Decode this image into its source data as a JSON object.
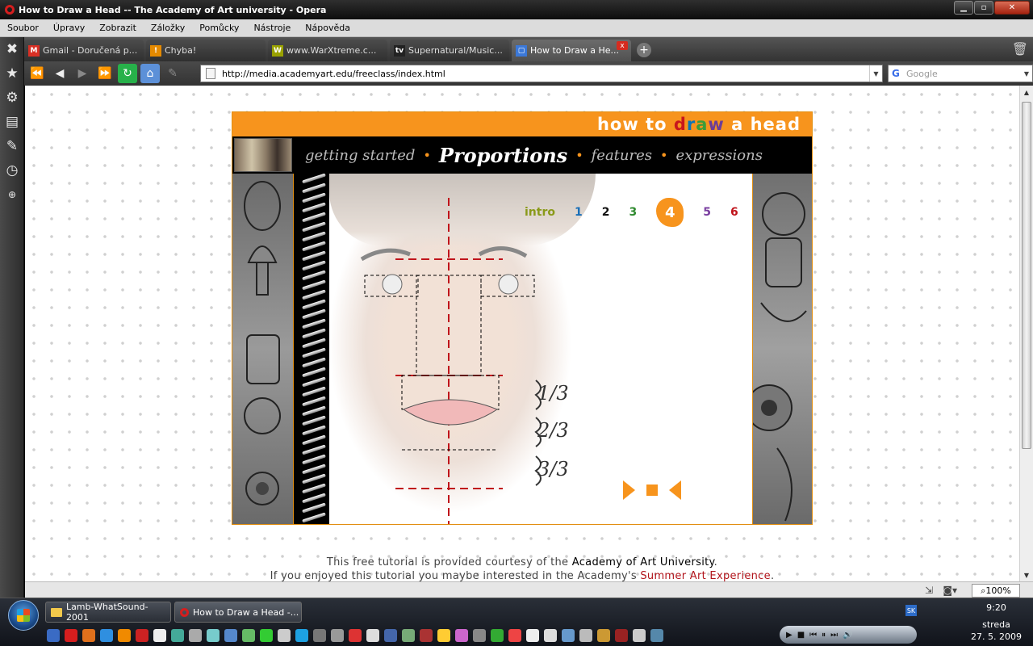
{
  "window": {
    "title": "How to Draw a Head -- The Academy of Art university - Opera",
    "minimize": "▁",
    "maximize": "▫",
    "close": "✕"
  },
  "menu": [
    "Soubor",
    "Úpravy",
    "Zobrazit",
    "Záložky",
    "Pomůcky",
    "Nástroje",
    "Nápověda"
  ],
  "tabs": [
    {
      "label": "Gmail - Doručená p...",
      "favicon": "M",
      "color": "#d93025"
    },
    {
      "label": "Chyba!",
      "favicon": "!",
      "color": "#e58a00"
    },
    {
      "label": "www.WarXtreme.c...",
      "favicon": "W",
      "color": "#9aa200"
    },
    {
      "label": "Supernatural/Music...",
      "favicon": "tv",
      "color": "#222222"
    },
    {
      "label": "How to Draw a He...",
      "favicon": "▢",
      "color": "#3b78d8",
      "active": true
    }
  ],
  "address": {
    "url": "http://media.academyart.edu/freeclass/index.html",
    "search_placeholder": "Google"
  },
  "panel_icons": [
    "bookmarks-icon",
    "settings-icon",
    "chat-icon",
    "feeds-icon",
    "history-icon",
    "add-panel-icon"
  ],
  "flash": {
    "title_start": "how to ",
    "title_d": "d",
    "title_r": "r",
    "title_a": "a",
    "title_w": "w",
    "title_end": " a head",
    "nav": {
      "getting_started": "getting started",
      "proportions": "Proportions",
      "features": "features",
      "expressions": "expressions",
      "sep": "•"
    },
    "steps": [
      {
        "label": "intro",
        "color": "#8a9a1a"
      },
      {
        "label": "1",
        "color": "#1a6fb8"
      },
      {
        "label": "2",
        "color": "#111111"
      },
      {
        "label": "3",
        "color": "#2f8a2f"
      },
      {
        "label": "4",
        "color": "#ffffff",
        "current": true
      },
      {
        "label": "5",
        "color": "#7a3fa0"
      },
      {
        "label": "6",
        "color": "#c0141b"
      }
    ],
    "fractions": [
      "1/3",
      "2/3",
      "3/3"
    ]
  },
  "credits": {
    "line1_pre": "This free tutorial is provided courtesy of the ",
    "line1_link": "Academy of Art University",
    "line1_post": ".",
    "line2_pre": "If you enjoyed this tutorial you maybe interested in the Academy's ",
    "line2_link": "Summer Art Experience",
    "line2_post": "."
  },
  "status": {
    "zoom": "100%"
  },
  "taskbar": {
    "buttons": [
      {
        "label": "Lamb-WhatSound-2001"
      },
      {
        "label": "How to Draw a Head -..."
      }
    ],
    "time": "9:20",
    "day": "streda",
    "date": "27. 5. 2009",
    "lang": "SK"
  }
}
